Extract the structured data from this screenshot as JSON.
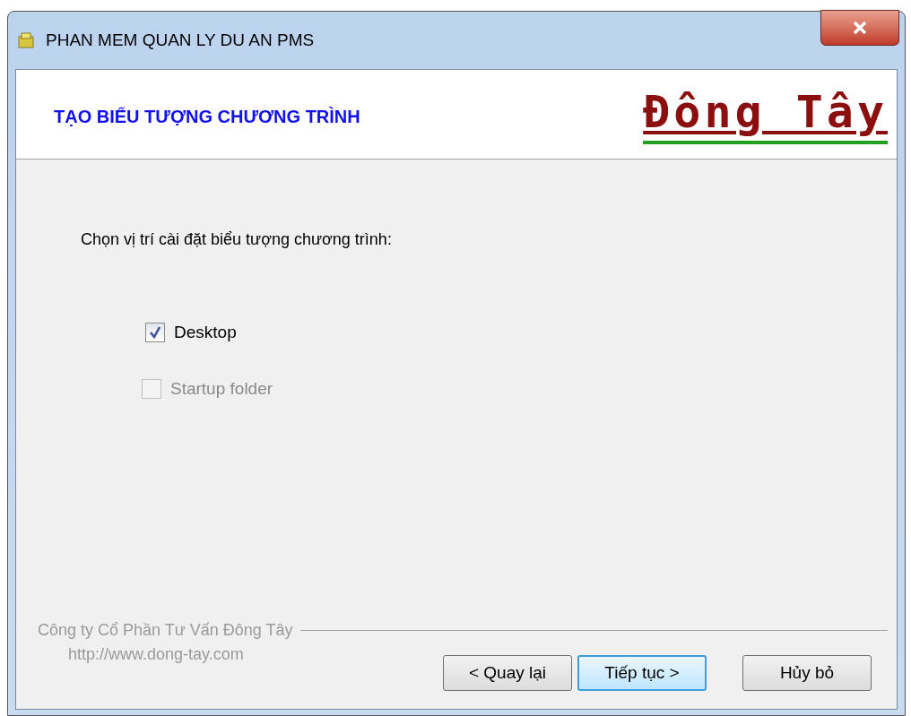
{
  "window": {
    "title": "PHAN MEM QUAN LY DU AN PMS"
  },
  "header": {
    "title": "TẠO BIỂU TƯỢNG CHƯƠNG TRÌNH",
    "logo": "Đông Tây"
  },
  "prompt": "Chọn vị trí cài đặt biểu tượng chương trình:",
  "options": [
    {
      "label": "Desktop",
      "checked": true,
      "disabled": false
    },
    {
      "label": "Startup folder",
      "checked": false,
      "disabled": true
    }
  ],
  "footer": {
    "company": "Công ty Cổ Phần Tư Vấn Đông Tây",
    "url": "http://www.dong-tay.com"
  },
  "buttons": [
    {
      "label": "< Quay lại",
      "default": false
    },
    {
      "label": "Tiếp tục >",
      "default": true
    },
    {
      "label": "Hủy bỏ",
      "default": false
    }
  ]
}
